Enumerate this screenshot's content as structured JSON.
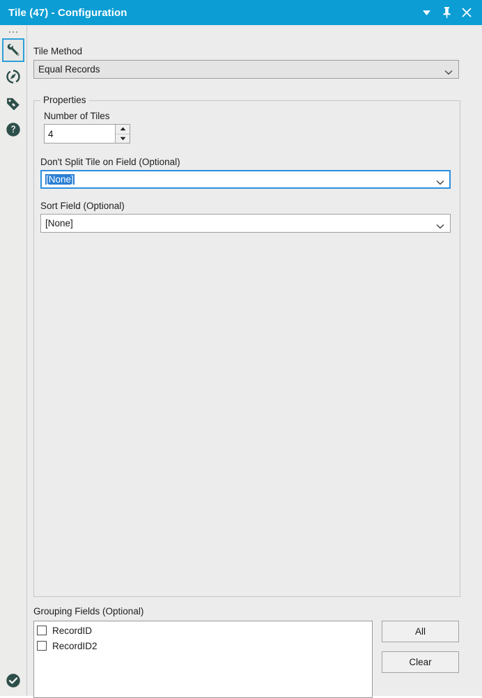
{
  "window": {
    "title": "Tile (47) - Configuration",
    "accent_color": "#0b9dd4",
    "background_color": "#ececec",
    "icon_color": "#2d4f4a",
    "controls": [
      {
        "name": "dropdown-menu",
        "label": "Menu"
      },
      {
        "name": "pin",
        "label": "Pin"
      },
      {
        "name": "close",
        "label": "Close"
      }
    ]
  },
  "sidebar": {
    "items": [
      {
        "name": "configuration",
        "icon": "wrench-icon",
        "selected": true
      },
      {
        "name": "annotation",
        "icon": "compass-icon",
        "selected": false
      },
      {
        "name": "labels",
        "icon": "tag-icon",
        "selected": false
      },
      {
        "name": "help",
        "icon": "question-icon",
        "selected": false
      }
    ],
    "bottom": {
      "name": "status",
      "icon": "check-circle-icon"
    }
  },
  "form": {
    "tile_method": {
      "label": "Tile Method",
      "value": "Equal Records",
      "style": "gray"
    },
    "properties_group": {
      "title": "Properties"
    },
    "number_of_tiles": {
      "label": "Number of Tiles",
      "value": "4"
    },
    "dont_split": {
      "label": "Don't Split Tile on Field (Optional)",
      "value": "[None]",
      "focused": true,
      "text_selected": true
    },
    "sort_field": {
      "label": "Sort Field (Optional)",
      "value": "[None]",
      "focused": false,
      "text_selected": false
    },
    "grouping_fields": {
      "label": "Grouping Fields (Optional)",
      "items": [
        {
          "label": "RecordID",
          "checked": false
        },
        {
          "label": "RecordID2",
          "checked": false
        }
      ],
      "all_button": "All",
      "clear_button": "Clear"
    }
  }
}
